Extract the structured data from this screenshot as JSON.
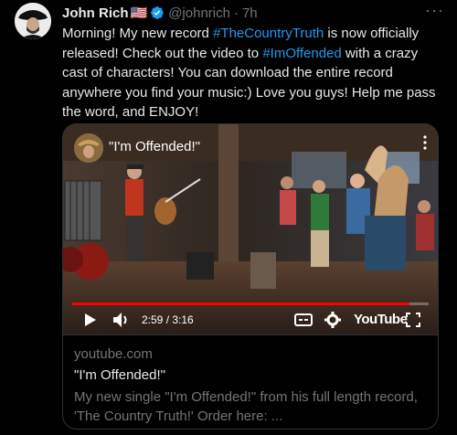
{
  "post": {
    "author_name": "John Rich",
    "flag": "🇺🇸",
    "handle": "@johnrich",
    "separator": "·",
    "time": "7h",
    "more": "···",
    "text_parts": {
      "p1": "Morning! My new record ",
      "tag1": "#TheCountryTruth",
      "p2": " is now officially released! Check out the video to ",
      "tag2": "#ImOffended",
      "p3": " with a crazy cast of characters! You can download the entire record anywhere you find your music:) Love you guys! Help me pass the word, and ENJOY!"
    }
  },
  "video": {
    "title": "\"I'm Offended!\"",
    "current_time": "2:59",
    "time_sep": " / ",
    "duration": "3:16",
    "progress": 0.945,
    "brand": "YouTube"
  },
  "card": {
    "domain": "youtube.com",
    "title": "\"I'm Offended!\"",
    "description": "My new single \"I'm Offended!\" from his full length record, 'The Country Truth!' Order here: ..."
  },
  "colors": {
    "link": "#1d9bf0",
    "verified": "#1d9bf0",
    "progress": "#ff0000"
  }
}
